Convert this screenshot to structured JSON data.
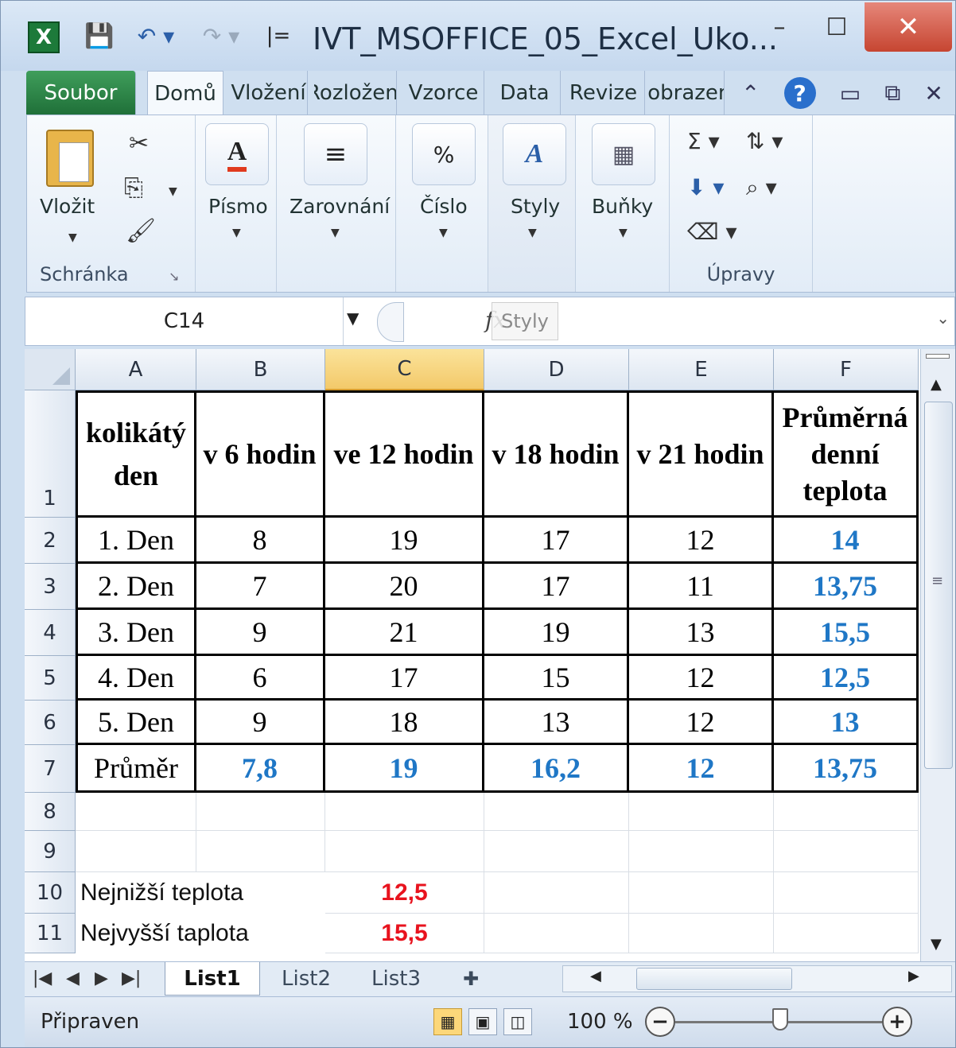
{
  "window": {
    "title": "IVT_MSOFFICE_05_Excel_Uko...",
    "app_icon_letter": "X",
    "min": "–",
    "max": "☐",
    "close": "✕"
  },
  "quick_access": {
    "save": "💾",
    "undo": "↶ ▾",
    "redo": "↷ ▾",
    "customize": "|="
  },
  "tabs": [
    {
      "id": "file",
      "label": "Soubor"
    },
    {
      "id": "home",
      "label": "Domů"
    },
    {
      "id": "insert",
      "label": "Vložení"
    },
    {
      "id": "layout",
      "label": "Rozložení"
    },
    {
      "id": "formulas",
      "label": "Vzorce"
    },
    {
      "id": "data",
      "label": "Data"
    },
    {
      "id": "review",
      "label": "Revize"
    },
    {
      "id": "view",
      "label": "Zobrazení"
    }
  ],
  "ribbon": {
    "clipboard": {
      "paste": "Vložit",
      "group": "Schránka",
      "launcher": "↘"
    },
    "font": {
      "label": "Písmo",
      "icon": "A"
    },
    "alignment": {
      "label": "Zarovnání",
      "icon": "≡"
    },
    "number": {
      "label": "Číslo",
      "icon": "%"
    },
    "styles": {
      "label": "Styly",
      "icon": "A"
    },
    "cells": {
      "label": "Buňky",
      "icon": "▦"
    },
    "editing": {
      "group": "Úpravy",
      "sum": "Σ ▾",
      "sort": "⇅ ▾",
      "fill": "⬇ ▾",
      "find": "⌕ ▾",
      "clear": "⌫ ▾"
    }
  },
  "formula_bar": {
    "name_box": "C14",
    "fx": "fx",
    "tooltip": "Styly"
  },
  "columns": [
    "A",
    "B",
    "C",
    "D",
    "E",
    "F"
  ],
  "selected_column": "C",
  "rows": [
    "1",
    "2",
    "3",
    "4",
    "5",
    "6",
    "7",
    "8",
    "9",
    "10",
    "11"
  ],
  "table": {
    "header": [
      "kolikátý den",
      "v 6 hodin",
      "ve 12 hodin",
      "v 18 hodin",
      "v 21 hodin",
      "Průměrná denní teplota"
    ],
    "body": [
      [
        "1. Den",
        "8",
        "19",
        "17",
        "12",
        "14"
      ],
      [
        "2. Den",
        "7",
        "20",
        "17",
        "11",
        "13,75"
      ],
      [
        "3. Den",
        "9",
        "21",
        "19",
        "13",
        "15,5"
      ],
      [
        "4. Den",
        "6",
        "17",
        "15",
        "12",
        "12,5"
      ],
      [
        "5. Den",
        "9",
        "18",
        "13",
        "12",
        "13"
      ]
    ],
    "average": [
      "Průměr",
      "7,8",
      "19",
      "16,2",
      "12",
      "13,75"
    ]
  },
  "summary": [
    {
      "label": "Nejnižší teplota",
      "value": "12,5"
    },
    {
      "label": "Nejvyšší taplota",
      "value": "15,5"
    }
  ],
  "sheets": [
    {
      "id": "1",
      "label": "List1"
    },
    {
      "id": "2",
      "label": "List2"
    },
    {
      "id": "3",
      "label": "List3"
    }
  ],
  "sheet_nav": {
    "first": "|◀",
    "prev": "◀",
    "next": "▶",
    "last": "▶|"
  },
  "status": {
    "text": "Připraven",
    "zoom": "100 %",
    "minus": "−",
    "plus": "+"
  },
  "colors": {
    "accent_blue": "#1f77c6",
    "accent_red": "#e8131e",
    "file_tab": "#1f6f38",
    "close_button": "#c64531"
  }
}
